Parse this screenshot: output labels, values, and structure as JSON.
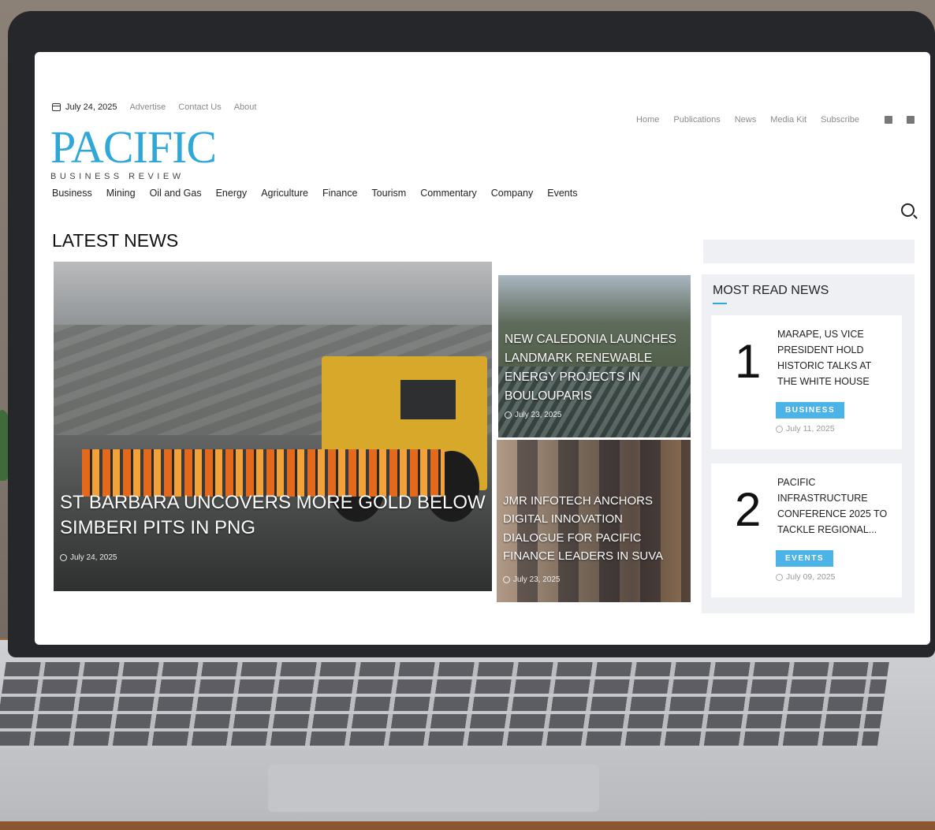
{
  "topbar": {
    "date": "July 24, 2025",
    "links": [
      "Advertise",
      "Contact Us",
      "About"
    ]
  },
  "brand": {
    "name": "PACIFIC",
    "tagline": "BUSINESS REVIEW",
    "accent_color": "#2fa7d8"
  },
  "right_nav": {
    "items": [
      "Home",
      "Publications",
      "News",
      "Media Kit",
      "Subscribe"
    ],
    "social_icons": [
      "facebook-icon",
      "linkedin-icon"
    ]
  },
  "categories": [
    "Business",
    "Mining",
    "Oil and Gas",
    "Energy",
    "Agriculture",
    "Finance",
    "Tourism",
    "Commentary",
    "Company",
    "Events"
  ],
  "latest": {
    "heading": "LATEST NEWS",
    "main": {
      "title": "ST BARBARA UNCOVERS MORE GOLD BELOW SIMBERI PITS IN PNG",
      "date": "July 24, 2025"
    },
    "side": [
      {
        "title": "NEW CALEDONIA LAUNCHES LANDMARK RENEWABLE ENERGY PROJECTS IN BOULOUPARIS",
        "date": "July 23, 2025"
      },
      {
        "title": "JMR INFOTECH ANCHORS DIGITAL INNOVATION DIALOGUE FOR PACIFIC FINANCE LEADERS IN SUVA",
        "date": "July 23, 2025"
      }
    ]
  },
  "most_read": {
    "heading": "MOST READ NEWS",
    "items": [
      {
        "rank": "1",
        "title": "MARAPE, US VICE PRESIDENT HOLD HISTORIC TALKS AT THE WHITE HOUSE",
        "category": "BUSINESS",
        "date": "July 11, 2025"
      },
      {
        "rank": "2",
        "title": "PACIFIC INFRASTRUCTURE CONFERENCE 2025 TO TACKLE REGIONAL...",
        "category": "EVENTS",
        "date": "July 09, 2025"
      }
    ]
  }
}
